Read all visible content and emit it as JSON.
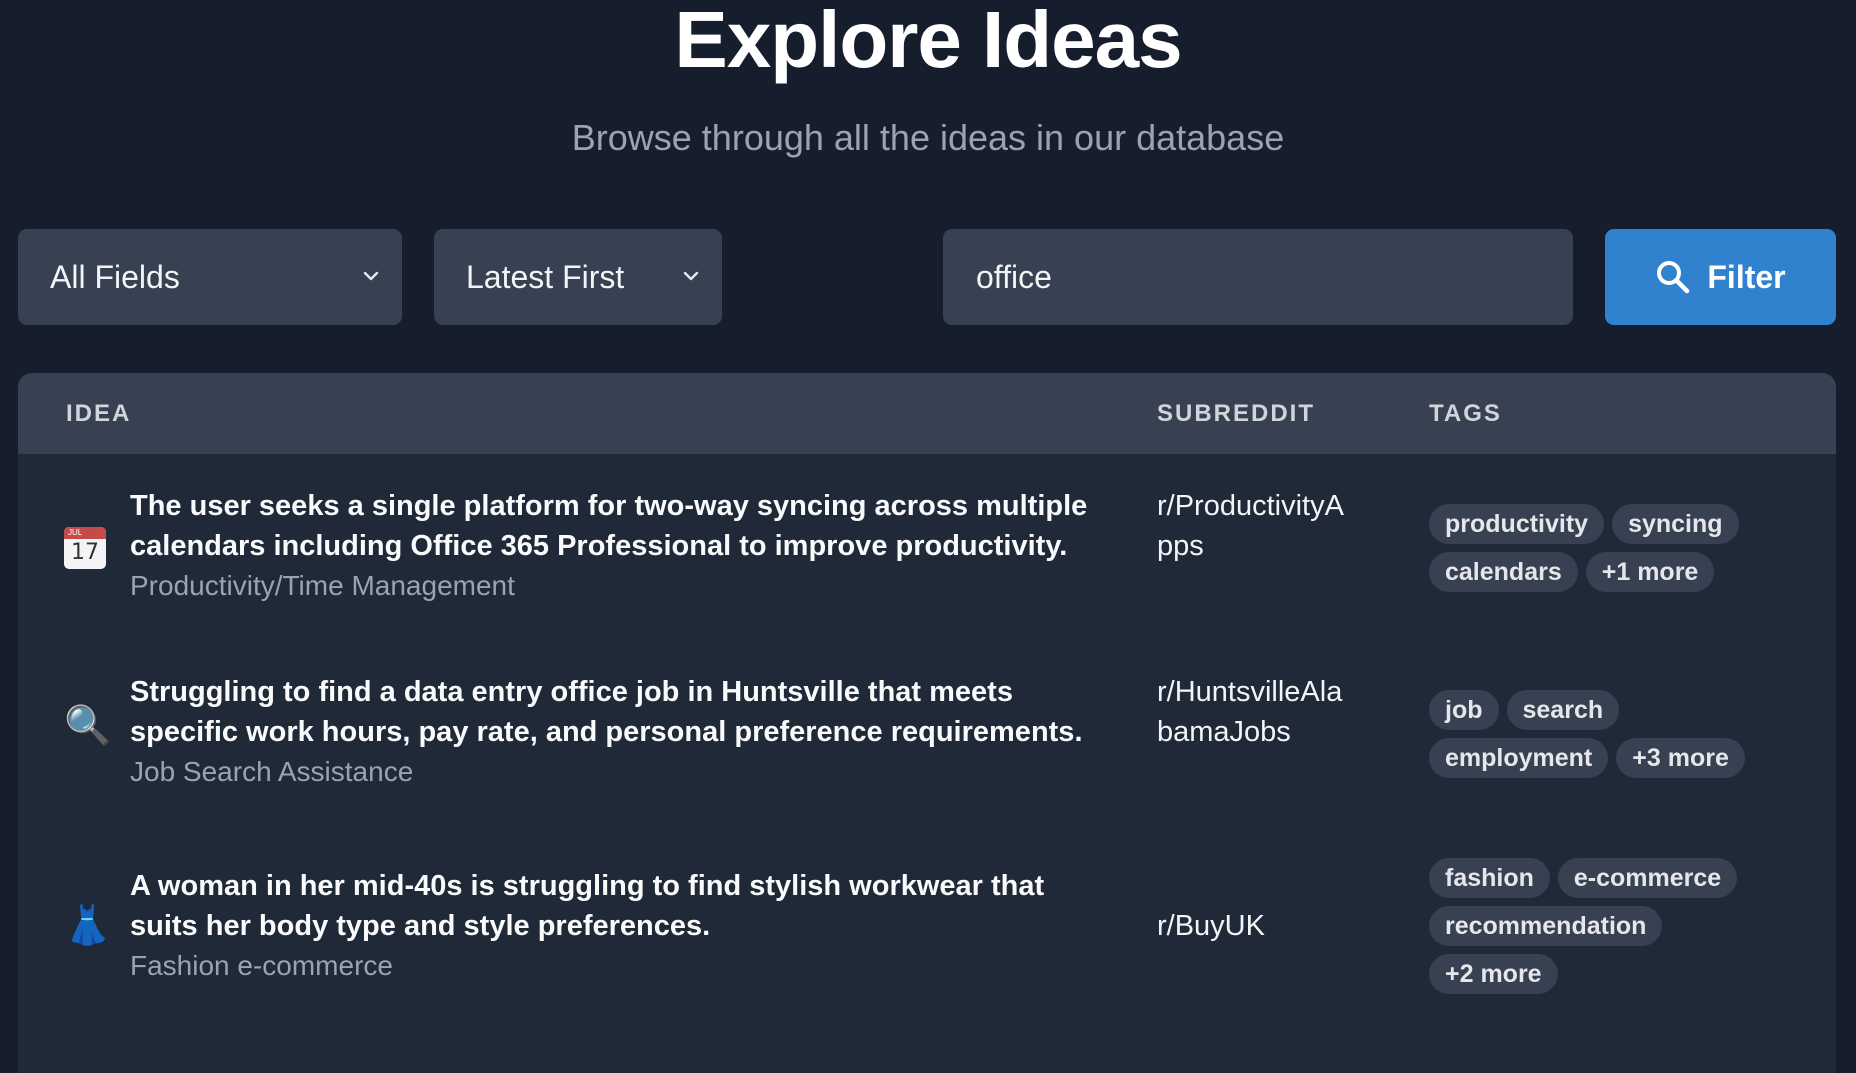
{
  "header": {
    "title": "Explore Ideas",
    "subtitle": "Browse through all the ideas in our database"
  },
  "filters": {
    "field_select": "All Fields",
    "sort_select": "Latest First",
    "search_value": "office",
    "filter_button": "Filter"
  },
  "table": {
    "columns": [
      "IDEA",
      "SUBREDDIT",
      "TAGS"
    ],
    "rows": [
      {
        "icon": "calendar-icon",
        "calendar_month": "JUL",
        "calendar_day": "17",
        "title": "The user seeks a single platform for two-way syncing across multiple calendars including Office 365 Professional to improve productivity.",
        "category": "Productivity/Time Management",
        "subreddit": "r/ProductivityApps",
        "tags": [
          "productivity",
          "syncing",
          "calendars",
          "+1 more"
        ]
      },
      {
        "icon": "magnifying-glass-icon",
        "glyph": "🔍",
        "title": "Struggling to find a data entry office job in Huntsville that meets specific work hours, pay rate, and personal preference requirements.",
        "category": "Job Search Assistance",
        "subreddit": "r/HuntsvilleAlabamaJobs",
        "tags": [
          "job",
          "search",
          "employment",
          "+3 more"
        ]
      },
      {
        "icon": "dress-icon",
        "glyph": "👗",
        "title": "A woman in her mid-40s is struggling to find stylish workwear that suits her body type and style preferences.",
        "category": "Fashion e-commerce",
        "subreddit": "r/BuyUK",
        "tags": [
          "fashion",
          "e-commerce",
          "recommendation",
          "+2 more"
        ]
      }
    ]
  }
}
